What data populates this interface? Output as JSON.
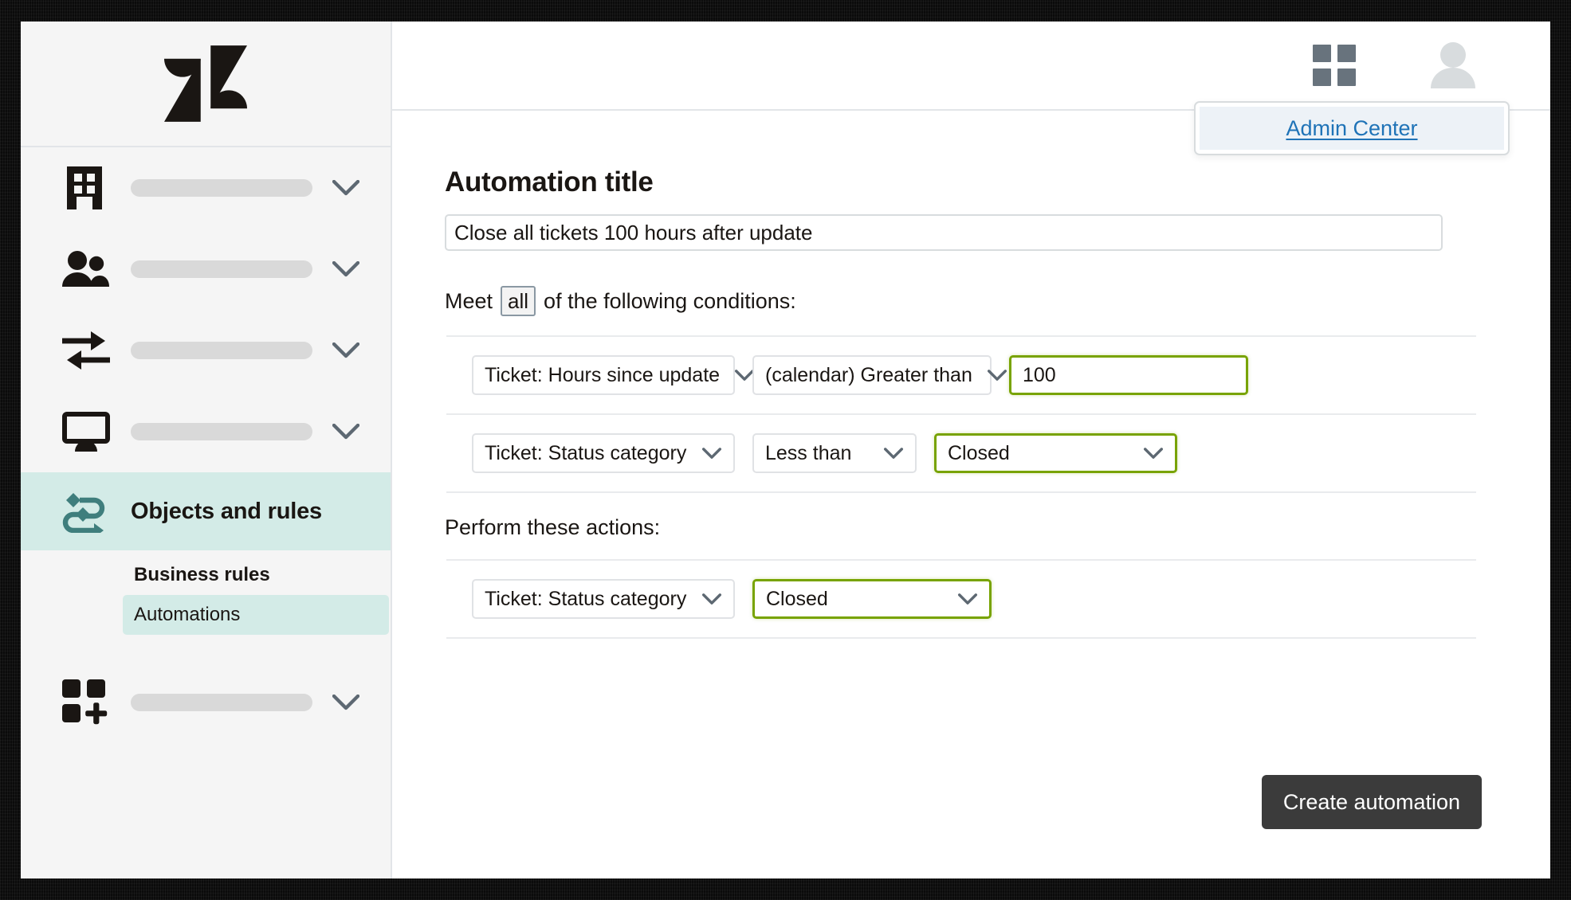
{
  "brand": {
    "logo_name": "zendesk-logo",
    "accent_teal": "#3f7e7d",
    "highlight_teal": "#d3ebe7",
    "focus_green": "#78a300",
    "link_blue": "#1f73b7"
  },
  "topbar": {
    "grid_icon": "grid-icon",
    "avatar_icon": "avatar-icon",
    "popover": {
      "link_label": "Admin Center"
    }
  },
  "sidebar": {
    "items": [
      {
        "icon": "building-icon",
        "label": "",
        "placeholder_bar": true,
        "chevron": true
      },
      {
        "icon": "people-icon",
        "label": "",
        "placeholder_bar": true,
        "chevron": true
      },
      {
        "icon": "transfer-arrows-icon",
        "label": "",
        "placeholder_bar": true,
        "chevron": true
      },
      {
        "icon": "monitor-icon",
        "label": "",
        "placeholder_bar": true,
        "chevron": true
      },
      {
        "icon": "objects-rules-icon",
        "label": "Objects and rules",
        "placeholder_bar": false,
        "chevron": false,
        "active": true
      },
      {
        "icon": "apps-add-icon",
        "label": "",
        "placeholder_bar": true,
        "chevron": true
      }
    ],
    "subitems": [
      {
        "label": "Business rules",
        "selected": false
      },
      {
        "label": "Automations",
        "selected": true
      }
    ]
  },
  "main": {
    "page_title": "Automation title",
    "title_field": {
      "value": "Close all tickets 100 hours after update",
      "placeholder": "Automation title"
    },
    "conditions": {
      "prefix": "Meet",
      "match_value": "all",
      "suffix": "of the following conditions:",
      "rows": [
        {
          "field": "Ticket: Hours since update",
          "operator": "(calendar) Greater than",
          "value": "100",
          "value_is_input": true,
          "value_focused": true
        },
        {
          "field": "Ticket: Status category",
          "operator": "Less than",
          "value": "Closed",
          "value_is_input": false,
          "value_focused": true
        }
      ]
    },
    "actions": {
      "label": "Perform these actions:",
      "rows": [
        {
          "field": "Ticket: Status category",
          "value": "Closed",
          "value_focused": true
        }
      ]
    },
    "submit_label": "Create automation"
  }
}
